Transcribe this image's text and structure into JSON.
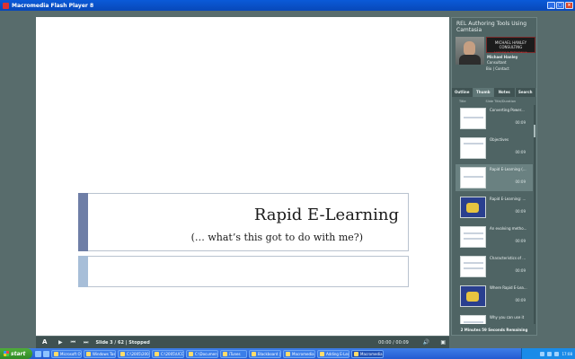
{
  "window": {
    "title": "Macromedia Flash Player 8"
  },
  "slide": {
    "title": "Rapid E-Learning",
    "subtitle": "(… what’s this got to do with me?)"
  },
  "controls": {
    "slide_status": "Slide 3 / 62 | Stopped",
    "time": "00:00 / 00:09"
  },
  "sidebar": {
    "title": "REL Authoring Tools Using Camtasia",
    "logo_text": "MICHAEL HANLEY CONSULTING",
    "logo_tag": "Learning & Performance",
    "presenter_name": "Michael Hanley",
    "presenter_role": "Consultant",
    "presenter_links": "Bio | Contact",
    "tabs": [
      "Outline",
      "Thumb",
      "Notes",
      "Search"
    ],
    "col_headers": [
      "Title",
      "Slide Title/Duration"
    ],
    "thumbs": [
      {
        "title": "Converting Power...",
        "time": "00:09"
      },
      {
        "title": "Objectives",
        "time": "00:09"
      },
      {
        "title": "Rapid E-Learning (...",
        "time": "00:09"
      },
      {
        "title": "Rapid E-Learning: ...",
        "time": "00:09"
      },
      {
        "title": "An evolving metho...",
        "time": "00:09"
      },
      {
        "title": "Characteristics of ...",
        "time": "00:09"
      },
      {
        "title": "Where Rapid E-Lea...",
        "time": "00:09"
      },
      {
        "title": "Why you can use it",
        "time": ""
      }
    ],
    "remaining": "2 Minutes 59 Seconds Remaining"
  },
  "taskbar": {
    "start_label": "start",
    "tasks": [
      "Microsoft Of...",
      "Windows Task M...",
      "C:\\2005\\2005 C...",
      "C:\\2005\\UCC Se...",
      "C:\\Documents a...",
      "iTunes",
      "Blackboard | Ho...",
      "Macromedia Fire...",
      "Adding E-Learn...",
      "Macromedia Flas..."
    ],
    "clock": "17:08"
  }
}
